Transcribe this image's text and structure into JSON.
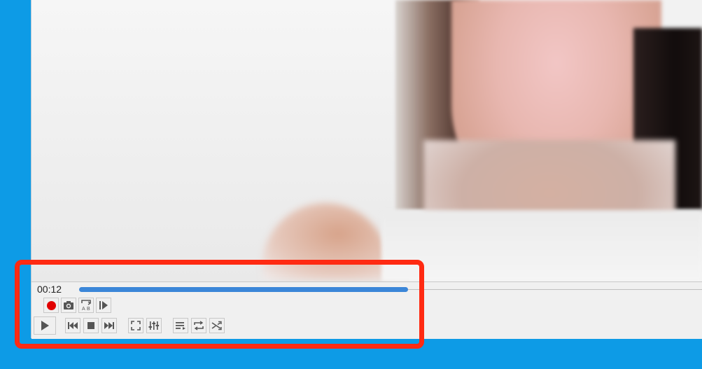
{
  "player": {
    "time": "00:12",
    "progress_fraction": 0.49,
    "seek_color": "#3b86d8"
  },
  "toolbar_top": [
    {
      "icon": "record-icon",
      "color": "#e10000"
    },
    {
      "icon": "snapshot-icon"
    },
    {
      "icon": "ab-loop-icon",
      "label_a": "A",
      "label_b": "B"
    },
    {
      "icon": "frame-step-icon"
    }
  ],
  "toolbar_bottom": [
    {
      "icon": "play-icon"
    },
    {
      "icon": "previous-icon"
    },
    {
      "icon": "stop-icon"
    },
    {
      "icon": "next-icon"
    },
    {
      "icon": "fullscreen-icon"
    },
    {
      "icon": "extended-settings-icon"
    },
    {
      "icon": "playlist-icon"
    },
    {
      "icon": "loop-icon"
    },
    {
      "icon": "shuffle-icon"
    }
  ],
  "annotation": {
    "color": "#ff2a12"
  }
}
